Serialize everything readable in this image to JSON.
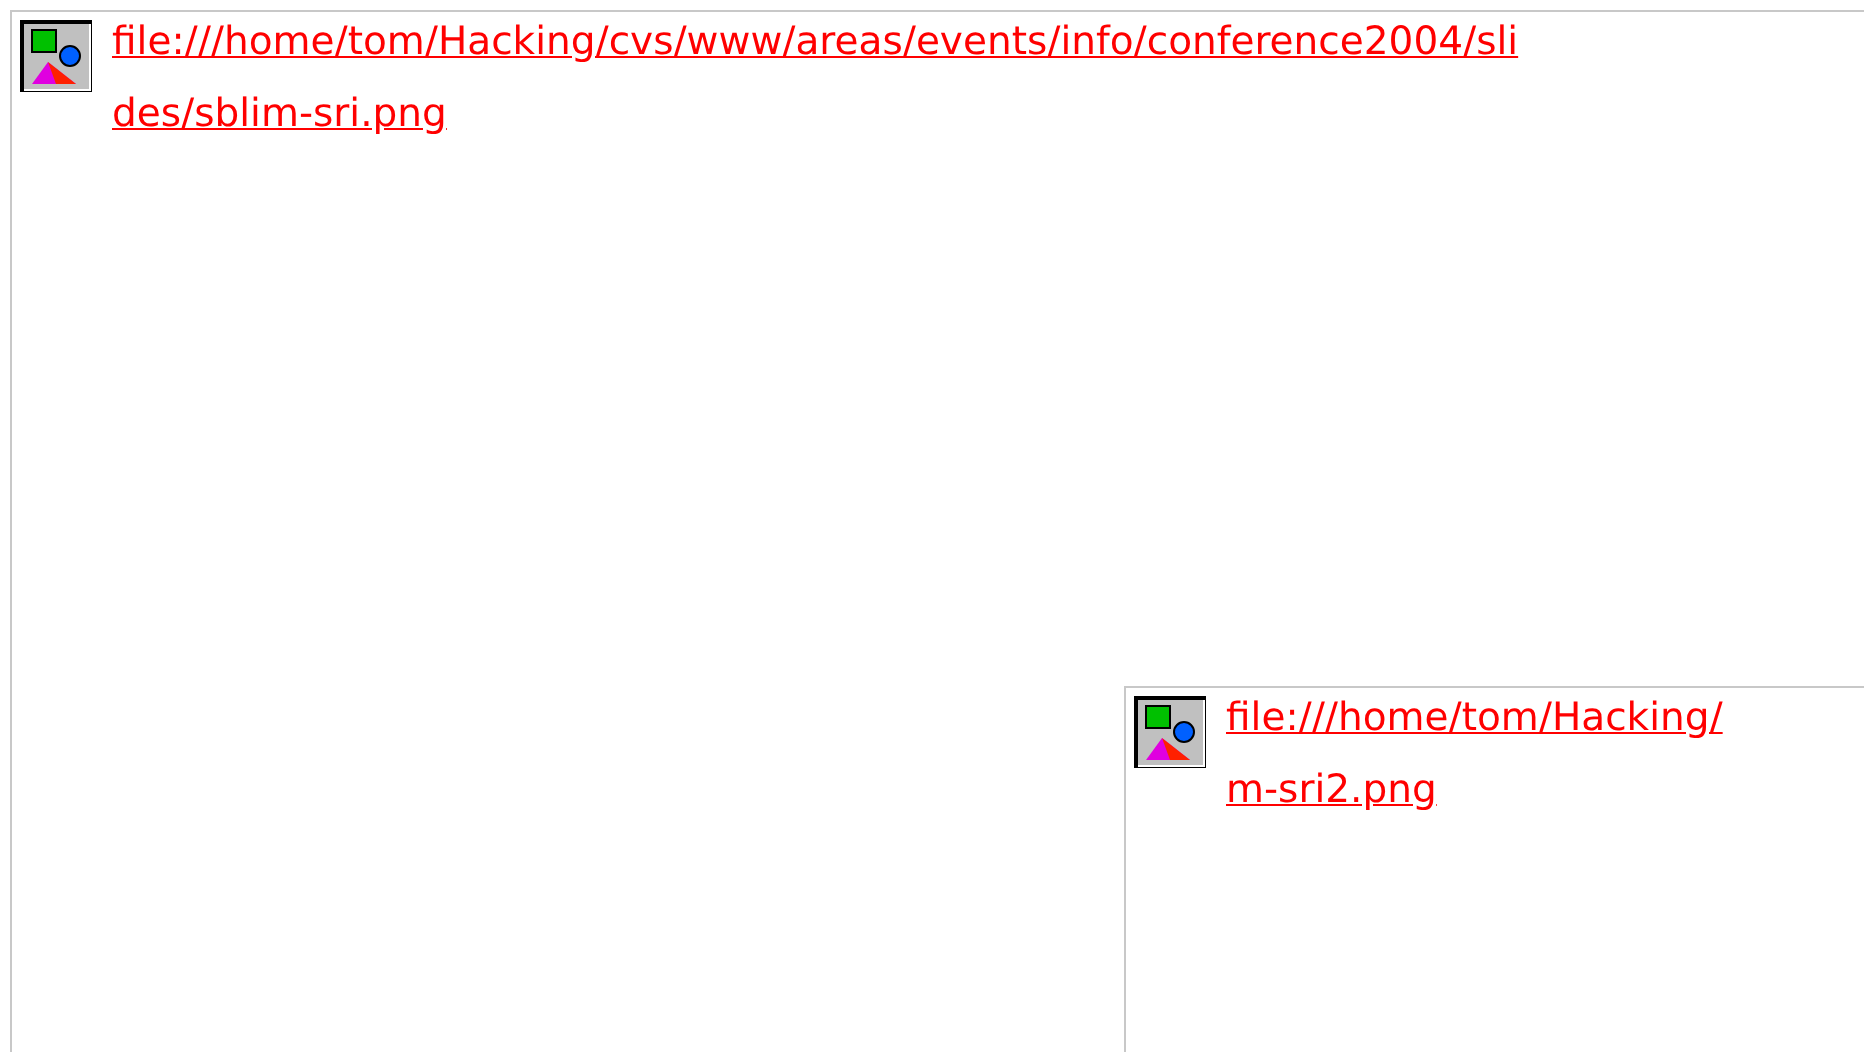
{
  "broken_images": [
    {
      "link_lines": [
        "file:///home/tom/Hacking/cvs/www/areas/events/info/conference2004/sli",
        "des/sblim-sri.png"
      ]
    },
    {
      "link_lines": [
        "file:///home/tom/Hacking/",
        "m-sri2.png"
      ]
    }
  ]
}
